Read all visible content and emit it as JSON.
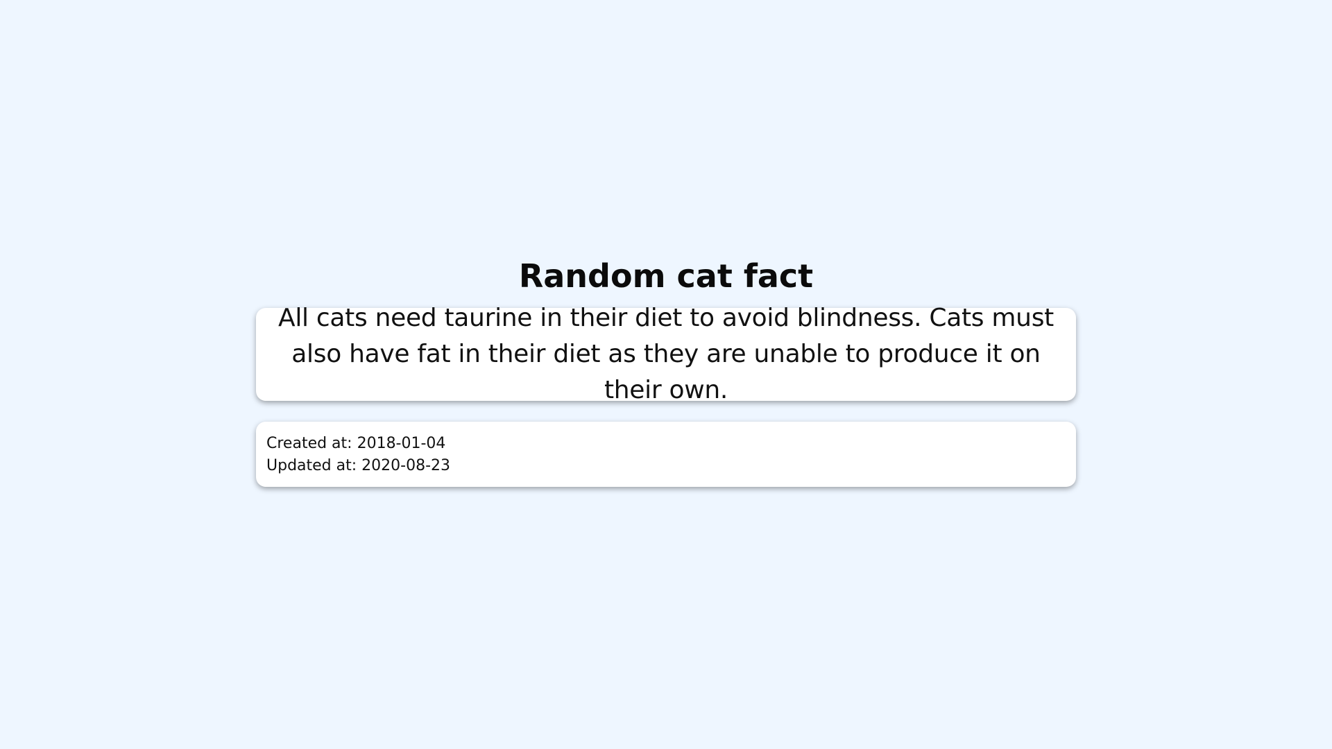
{
  "page": {
    "title": "Random cat fact",
    "background_color": "#eef6ff"
  },
  "fact": {
    "text": "All cats need taurine in their diet to avoid blindness. Cats must also have fat in their diet as they are unable to produce it on their own."
  },
  "meta": {
    "created": "Created at: 2018-01-04",
    "updated": "Updated at: 2020-08-23"
  }
}
